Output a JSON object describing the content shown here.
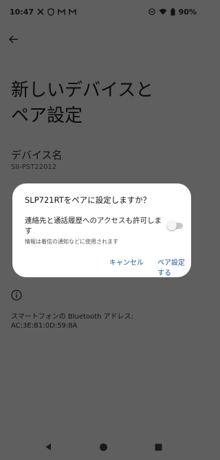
{
  "status_bar": {
    "time": "10:47",
    "battery": "90%",
    "left_icons": [
      "twitter-icon",
      "shield-icon",
      "gmail-icon",
      "gmail-icon"
    ],
    "right_icons": [
      "dnd-icon",
      "wifi-icon",
      "battery-icon"
    ]
  },
  "page": {
    "title_line1": "新しいデバイスと",
    "title_line2": "ペア設定",
    "device_name_label": "デバイス名",
    "device_name_value": "SII-PST22012",
    "bt_address_line1": "スマートフォンの Bluetooth アドレス:",
    "bt_address_line2": "AC:3E:B1:0D:59:8A"
  },
  "dialog": {
    "title": "SLP721RTをペアに設定しますか？",
    "contact_access_line1": "連絡先と通話履歴へのアクセスも許可しま",
    "contact_access_line2": "す",
    "note": "情報は着信の通知などに使用されます",
    "toggle_on": false,
    "cancel_label": "キャンセル",
    "pair_label": "ペア設定する"
  },
  "colors": {
    "scrim_background": "#5f5f5f",
    "dialog_background": "#ffffff",
    "accent": "#1a55a8"
  }
}
